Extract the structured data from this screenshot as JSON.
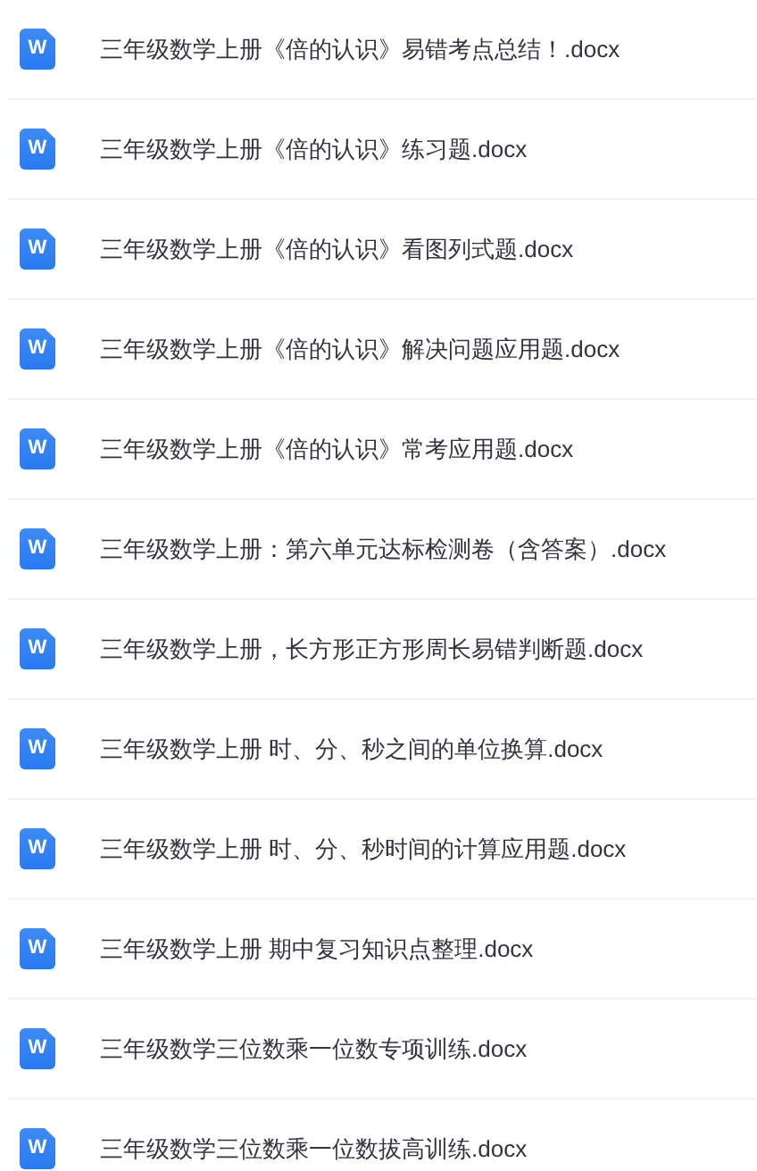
{
  "files": [
    {
      "icon_letter": "W",
      "name": "三年级数学上册《倍的认识》易错考点总结！.docx"
    },
    {
      "icon_letter": "W",
      "name": "三年级数学上册《倍的认识》练习题.docx"
    },
    {
      "icon_letter": "W",
      "name": "三年级数学上册《倍的认识》看图列式题.docx"
    },
    {
      "icon_letter": "W",
      "name": "三年级数学上册《倍的认识》解决问题应用题.docx"
    },
    {
      "icon_letter": "W",
      "name": "三年级数学上册《倍的认识》常考应用题.docx"
    },
    {
      "icon_letter": "W",
      "name": "三年级数学上册：第六单元达标检测卷（含答案）.docx"
    },
    {
      "icon_letter": "W",
      "name": "三年级数学上册，长方形正方形周长易错判断题.docx"
    },
    {
      "icon_letter": "W",
      "name": "三年级数学上册 时、分、秒之间的单位换算.docx"
    },
    {
      "icon_letter": "W",
      "name": "三年级数学上册 时、分、秒时间的计算应用题.docx"
    },
    {
      "icon_letter": "W",
      "name": "三年级数学上册 期中复习知识点整理.docx"
    },
    {
      "icon_letter": "W",
      "name": "三年级数学三位数乘一位数专项训练.docx"
    },
    {
      "icon_letter": "W",
      "name": "三年级数学三位数乘一位数拔高训练.docx"
    }
  ]
}
